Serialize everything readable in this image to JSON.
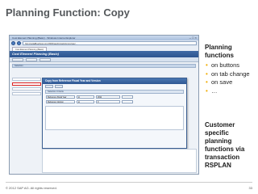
{
  "slide": {
    "title": "Planning Function: Copy",
    "footer_copyright": "© 2012 SAP AG. All rights reserved.",
    "page_number": "33"
  },
  "screenshot": {
    "window_title": "Cost Element Planning (Basic) - Windows Internet Explorer",
    "window_controls": "– □ ×",
    "address": "http://ustlaiBuethost.corp:8000/sap/bc/webdynpro/sap/...",
    "tab_label": "Cost Element Planning (Basic)",
    "app_header": "Cost Element Planning (Basic)",
    "panel_label": "Selection",
    "dialog_title": "Copy from Reference Fiscal Year and Version",
    "selection_head": "Selection Criteria",
    "fields": {
      "row1_label": "Reference Fiscal Year",
      "row1_op": "to",
      "row1_value": "2011",
      "row2_label": "Reference Version",
      "row2_op": "to",
      "row2_value": "0"
    }
  },
  "sidebar": {
    "heading": "Planning functions",
    "items": [
      "on buttons",
      "on tab change",
      "on save",
      "…"
    ],
    "note": "Customer specific planning functions via transaction RSPLAN"
  }
}
